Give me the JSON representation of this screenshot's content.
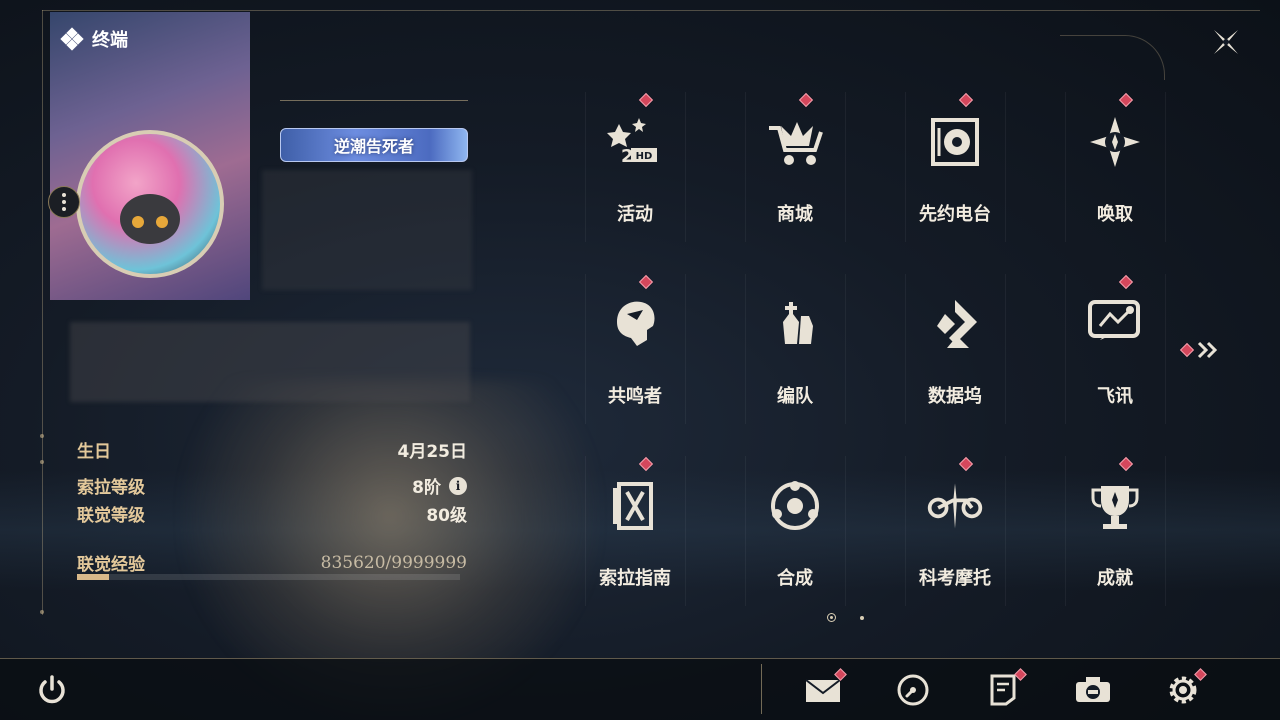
{
  "terminal": {
    "title": "终端"
  },
  "profile": {
    "title_badge": "逆潮告死者",
    "stats": [
      {
        "label": "生日",
        "value": "4月25日"
      },
      {
        "label": "索拉等级",
        "value": "8阶"
      },
      {
        "label": "联觉等级",
        "value": "80级"
      }
    ],
    "experience": {
      "label": "联觉经验",
      "value": "835620/9999999",
      "fraction": 0.084
    }
  },
  "menu": {
    "items": [
      {
        "label": "活动",
        "icon": "event-icon"
      },
      {
        "label": "商城",
        "icon": "shop-icon"
      },
      {
        "label": "先约电台",
        "icon": "radio-icon"
      },
      {
        "label": "唤取",
        "icon": "convene-icon"
      },
      {
        "label": "共鸣者",
        "icon": "resonator-icon"
      },
      {
        "label": "编队",
        "icon": "team-icon"
      },
      {
        "label": "数据坞",
        "icon": "data-bank-icon"
      },
      {
        "label": "飞讯",
        "icon": "message-icon"
      },
      {
        "label": "索拉指南",
        "icon": "guidebook-icon"
      },
      {
        "label": "合成",
        "icon": "synthesis-icon"
      },
      {
        "label": "科考摩托",
        "icon": "motorcycle-icon"
      },
      {
        "label": "成就",
        "icon": "achievement-icon"
      }
    ]
  },
  "bottom_bar": {
    "left": [
      "power-icon"
    ],
    "right": [
      "mail-icon",
      "timer-icon",
      "notice-icon",
      "camera-icon",
      "settings-icon"
    ]
  },
  "colors": {
    "accent_gold": "#d9b98a",
    "badge_red": "#d4475c",
    "title_blue": "#4c6bc0"
  }
}
